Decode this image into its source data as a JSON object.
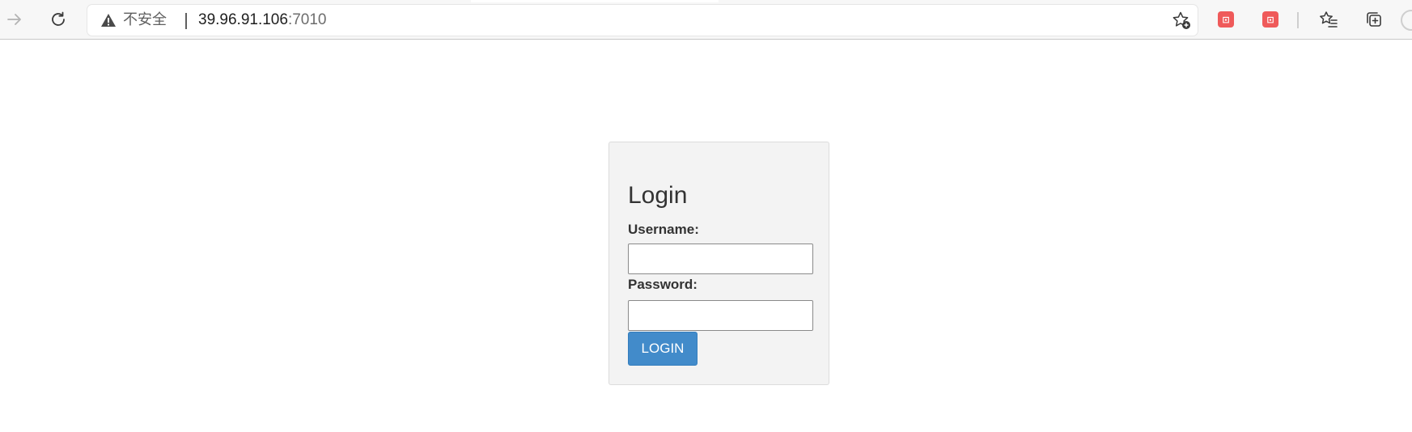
{
  "browser": {
    "security_label": "不安全",
    "url_host": "39.96.91.106",
    "url_port": ":7010",
    "icons": {
      "forward": "forward-arrow-icon",
      "reload": "reload-icon",
      "warning": "warning-triangle-icon",
      "add_favorite": "star-add-icon",
      "extension_1": "extension-badge-icon",
      "extension_2": "extension-badge-icon",
      "favorites": "favorites-list-icon",
      "collections": "collections-icon",
      "profile": "profile-avatar-icon"
    }
  },
  "login": {
    "title": "Login",
    "username_label": "Username:",
    "username_value": "",
    "password_label": "Password:",
    "password_value": "",
    "submit_label": "LOGIN"
  },
  "colors": {
    "button_bg": "#428bca",
    "panel_bg": "#f3f3f3",
    "extension_badge": "#ef5a5a"
  }
}
